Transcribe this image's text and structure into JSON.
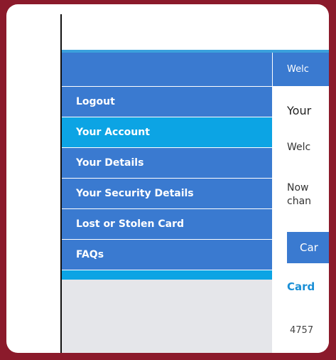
{
  "header": {
    "welcome_text": "Welc"
  },
  "sidebar": {
    "items": [
      {
        "label": "Logout"
      },
      {
        "label": "Your Account"
      },
      {
        "label": "Your Details"
      },
      {
        "label": "Your Security Details"
      },
      {
        "label": "Lost or Stolen Card"
      },
      {
        "label": "FAQs"
      }
    ],
    "active_index": 1
  },
  "main": {
    "title": "Your",
    "welcome": "Welc",
    "now_line1": "Now",
    "now_line2": "chan",
    "card_button": "Car",
    "card_link": "Card",
    "card_number": "4757"
  },
  "colors": {
    "background": "#8b1a2b",
    "nav_blue": "#3a7ad0",
    "active_blue": "#0ca4e4",
    "sidebar_gray": "#e5e6ea",
    "link_blue": "#1a8fd6"
  }
}
